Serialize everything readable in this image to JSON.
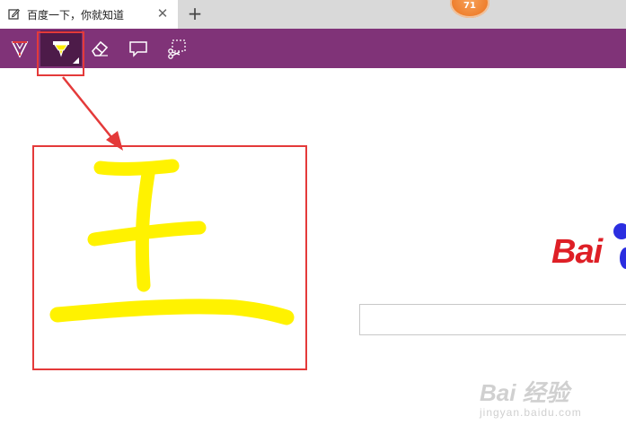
{
  "browser": {
    "tab": {
      "title": "百度一下，你就知道",
      "close_glyph": "✕"
    },
    "new_tab_glyph": "+",
    "notification_badge": "71"
  },
  "ink_toolbar": {
    "tools": [
      {
        "name": "ballpoint-pen",
        "icon": "pen-icon",
        "selected": false
      },
      {
        "name": "highlighter",
        "icon": "highlighter-icon",
        "selected": true,
        "color": "#ffff00"
      },
      {
        "name": "eraser",
        "icon": "eraser-icon",
        "selected": false
      },
      {
        "name": "add-typed-note",
        "icon": "comment-icon",
        "selected": false
      },
      {
        "name": "clip",
        "icon": "clip-icon",
        "selected": false
      }
    ],
    "background_color": "#803378"
  },
  "page": {
    "logo_text": "Bai",
    "watermark_main": "Bai 经验",
    "watermark_sub": "jingyan.baidu.com"
  },
  "annotation": {
    "color": "#e43a3a",
    "highlight_color": "#fff200"
  }
}
